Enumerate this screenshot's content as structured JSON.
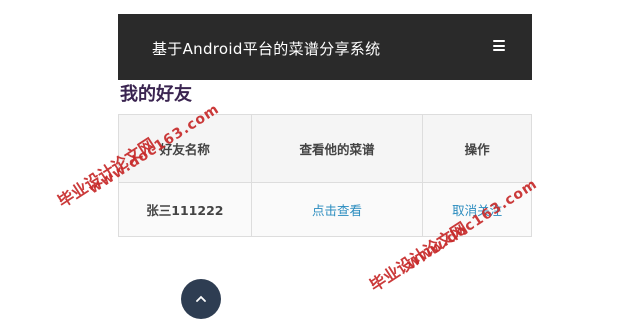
{
  "header": {
    "title": "基于Android平台的菜谱分享系统",
    "menu_icon": "hamburger-menu-icon"
  },
  "section_title": "我的好友",
  "table": {
    "headers": [
      "好友名称",
      "查看他的菜谱",
      "操作"
    ],
    "rows": [
      {
        "name": "张三111222",
        "view_link": "点击查看",
        "action_link": "取消关注"
      }
    ]
  },
  "scroll_top_icon": "chevron-up-icon",
  "watermarks": {
    "site_name": "毕业设计论文网",
    "url": "www.doc163.com"
  },
  "colors": {
    "header_bg": "#2a2a2a",
    "link": "#2a8cbf",
    "scroll_btn": "#2e3d52",
    "watermark": "#c72a2a"
  }
}
